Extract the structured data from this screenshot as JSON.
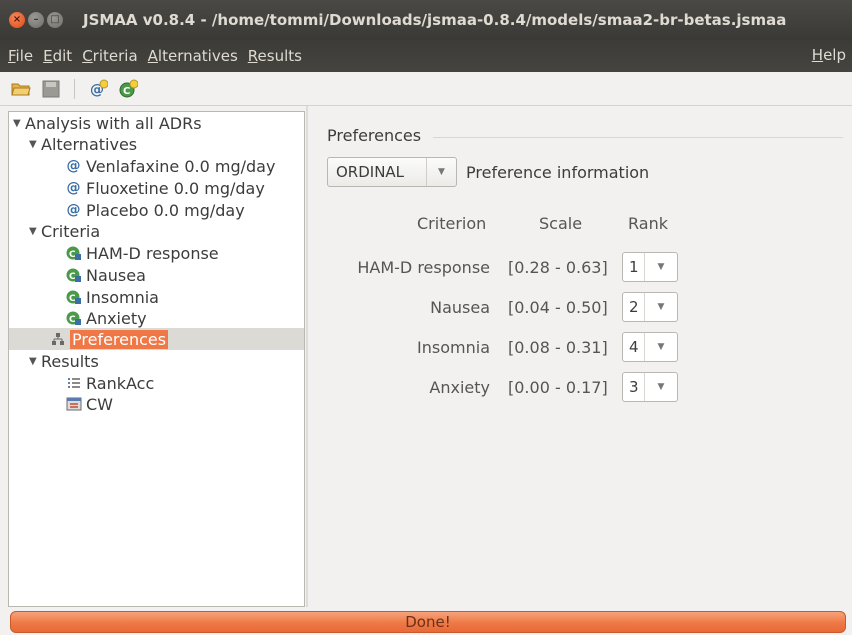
{
  "window": {
    "title": "JSMAA v0.8.4 - /home/tommi/Downloads/jsmaa-0.8.4/models/smaa2-br-betas.jsmaa"
  },
  "menubar": {
    "items": [
      {
        "label": "File",
        "mnemonic": "F",
        "rest": "ile"
      },
      {
        "label": "Edit",
        "mnemonic": "E",
        "rest": "dit"
      },
      {
        "label": "Criteria",
        "mnemonic": "C",
        "rest": "riteria"
      },
      {
        "label": "Alternatives",
        "mnemonic": "A",
        "rest": "lternatives"
      },
      {
        "label": "Results",
        "mnemonic": "R",
        "rest": "esults"
      }
    ],
    "help": {
      "mnemonic": "H",
      "rest": "elp"
    }
  },
  "toolbar": {
    "icons": [
      "open-folder-icon",
      "save-icon",
      "add-alternative-icon",
      "add-criterion-icon"
    ]
  },
  "tree": {
    "root": "Analysis with all ADRs",
    "alternatives_label": "Alternatives",
    "alternatives": [
      "Venlafaxine 0.0 mg/day",
      "Fluoxetine 0.0 mg/day",
      "Placebo 0.0 mg/day"
    ],
    "criteria_label": "Criteria",
    "criteria": [
      "HAM-D response",
      "Nausea",
      "Insomnia",
      "Anxiety"
    ],
    "preferences_label": "Preferences",
    "results_label": "Results",
    "results": [
      "RankAcc",
      "CW"
    ]
  },
  "preferences": {
    "title": "Preferences",
    "type_selected": "ORDINAL",
    "info_label": "Preference information",
    "headers": {
      "criterion": "Criterion",
      "scale": "Scale",
      "rank": "Rank"
    },
    "rows": [
      {
        "criterion": "HAM-D response",
        "scale": "[0.28 - 0.63]",
        "rank": "1"
      },
      {
        "criterion": "Nausea",
        "scale": "[0.04 - 0.50]",
        "rank": "2"
      },
      {
        "criterion": "Insomnia",
        "scale": "[0.08 - 0.31]",
        "rank": "4"
      },
      {
        "criterion": "Anxiety",
        "scale": "[0.00 - 0.17]",
        "rank": "3"
      }
    ]
  },
  "status": {
    "text": "Done!"
  },
  "colors": {
    "accent": "#f07746",
    "titlebar": "#3c3b37"
  }
}
